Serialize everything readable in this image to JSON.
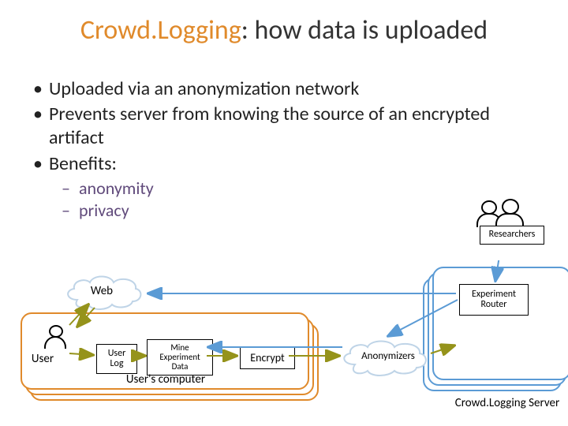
{
  "title": {
    "brand": "Crowd.Logging",
    "rest": ": how data is uploaded"
  },
  "bullets": {
    "b1": "Uploaded via an anonymization network",
    "b2": "Prevents server from knowing the source of an encrypted artifact",
    "b3": "Benefits:",
    "b3a": "anonymity",
    "b3b": "privacy"
  },
  "labels": {
    "researchers": "Researchers",
    "web": "Web",
    "experiment_router": "Experiment\nRouter",
    "user": "User",
    "user_log": "User\nLog",
    "mine": "Mine\nExperiment\nData",
    "encrypt": "Encrypt",
    "anonymizers": "Anonymizers",
    "users_computer": "User's computer",
    "server": "Crowd.Logging Server"
  },
  "colors": {
    "brand": "#e08a2b",
    "subbullet": "#604a7b",
    "cloud_border": "#bfd4e7",
    "arrow_olive": "#95931b",
    "arrow_blue": "#5b9bd5"
  }
}
